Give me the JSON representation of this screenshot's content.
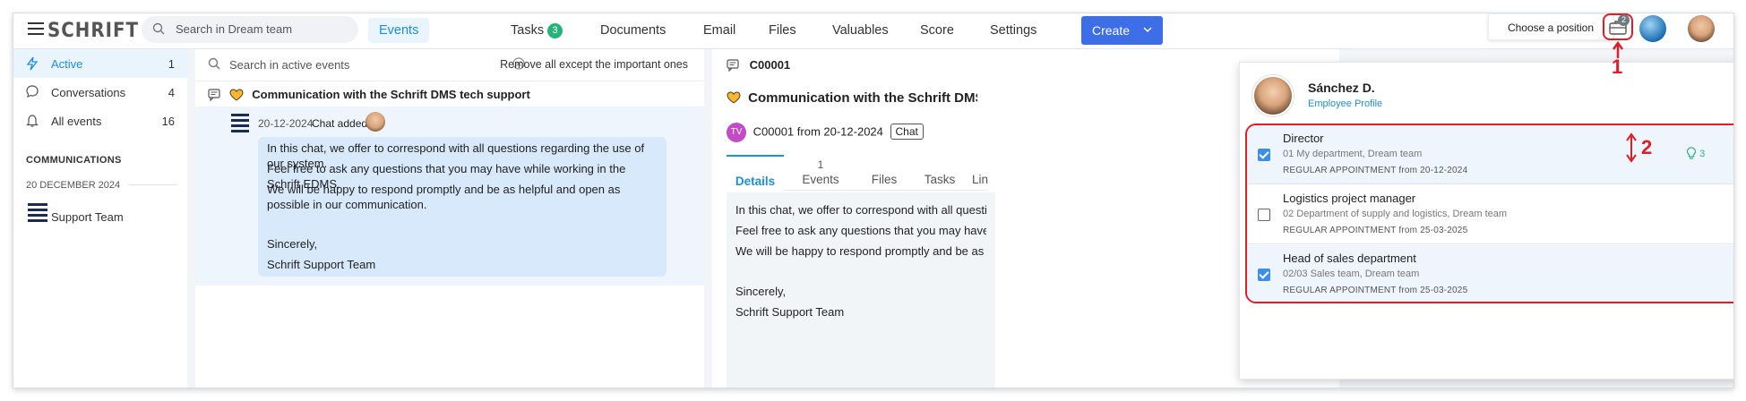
{
  "topbar": {
    "logo": "SCHRIFT",
    "search_placeholder": "Search in Dream team",
    "nav": [
      {
        "label": "Events"
      },
      {
        "label": "Tasks",
        "badge": "3"
      },
      {
        "label": "Documents"
      },
      {
        "label": "Email"
      },
      {
        "label": "Files"
      },
      {
        "label": "Valuables"
      },
      {
        "label": "Score"
      },
      {
        "label": "Settings"
      }
    ],
    "create_label": "Create",
    "choose_position": "Choose a position",
    "position_badge": "2"
  },
  "sidebar": {
    "items": [
      {
        "label": "Active",
        "count": "1"
      },
      {
        "label": "Conversations",
        "count": "4"
      },
      {
        "label": "All events",
        "count": "16"
      }
    ],
    "section_title": "COMMUNICATIONS",
    "date_header": "20 DECEMBER 2024",
    "team_label": "Support Team"
  },
  "middle": {
    "search_placeholder": "Search in active events",
    "remove_label": "Remove all except the important ones",
    "thread_title": "Communication with the Schrift DMS tech support",
    "entry_date": "20-12-2024",
    "entry_action": "Chat added",
    "message_lines": [
      "In this chat, we offer to correspond with all questions regarding the use of our system.",
      "Feel free to ask any questions that you may have while working in the Schrift EDMS.",
      "We will be happy to respond promptly and be as helpful and open as possible in our communication.",
      "Sincerely,",
      "Schrift Support Team"
    ]
  },
  "right": {
    "event_id": "C00001",
    "title": "Communication with the Schrift DMS tech support",
    "avatar_initials": "TV",
    "subtitle": "C00001 from 20-12-2024",
    "tag": "Chat",
    "tabs": [
      {
        "label": "Details",
        "count": ""
      },
      {
        "label": "Events",
        "count": "1"
      },
      {
        "label": "Files",
        "count": ""
      },
      {
        "label": "Tasks",
        "count": ""
      },
      {
        "label": "Lin",
        "count": ""
      }
    ],
    "body_lines": [
      "In this chat, we offer to correspond with all questions r",
      "Feel free to ask any questions that you may have while",
      "We will be happy to respond promptly and be as helpfu",
      "Sincerely,",
      "Schrift Support Team"
    ]
  },
  "popup": {
    "name": "Sánchez D.",
    "profile_link": "Employee Profile",
    "positions": [
      {
        "title": "Director",
        "dept": "01 My department, Dream team",
        "appointment": "REGULAR APPOINTMENT from 20-12-2024",
        "checked": true,
        "bulb_count": "3"
      },
      {
        "title": "Logistics project manager",
        "dept": "02 Department of supply and logistics, Dream team",
        "appointment": "REGULAR APPOINTMENT from 25-03-2025",
        "checked": false
      },
      {
        "title": "Head of sales department",
        "dept": "02/03 Sales team, Dream team",
        "appointment": "REGULAR APPOINTMENT from 25-03-2025",
        "checked": true
      }
    ]
  },
  "annotations": {
    "marker1": "1",
    "marker2": "2"
  },
  "colors": {
    "accent": "#1a8fe3",
    "create": "#3d6ee8",
    "highlight_red": "#e11d28",
    "badge_green": "#26b37a"
  }
}
